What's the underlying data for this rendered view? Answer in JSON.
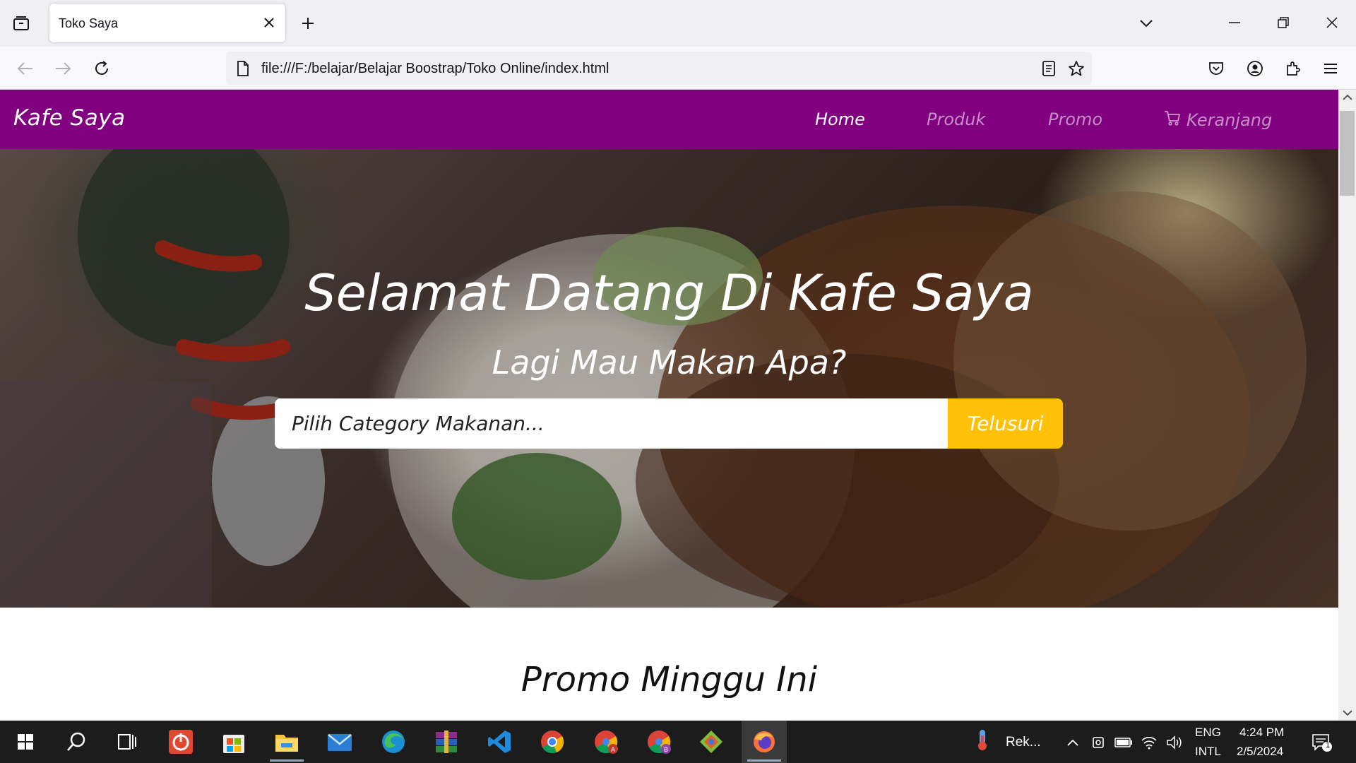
{
  "browser": {
    "tab_title": "Toko Saya",
    "url": "file:///F:/belajar/Belajar Boostrap/Toko Online/index.html"
  },
  "site": {
    "brand": "Kafe Saya",
    "menu": [
      {
        "label": "Home",
        "active": true
      },
      {
        "label": "Produk",
        "active": false
      },
      {
        "label": "Promo",
        "active": false
      },
      {
        "label": "Keranjang",
        "active": false,
        "icon": "cart-icon"
      }
    ],
    "hero": {
      "title": "Selamat Datang Di Kafe Saya",
      "subtitle": "Lagi Mau Makan Apa?",
      "search_placeholder": "Pilih Category Makanan...",
      "search_button": "Telusuri"
    },
    "promo_title": "Promo Minggu Ini",
    "colors": {
      "nav": "#800080",
      "button": "#ffc107"
    }
  },
  "taskbar": {
    "weather_label": "Rek...",
    "lang_top": "ENG",
    "lang_bottom": "INTL",
    "time": "4:24 PM",
    "date": "2/5/2024",
    "notification_count": "1"
  }
}
